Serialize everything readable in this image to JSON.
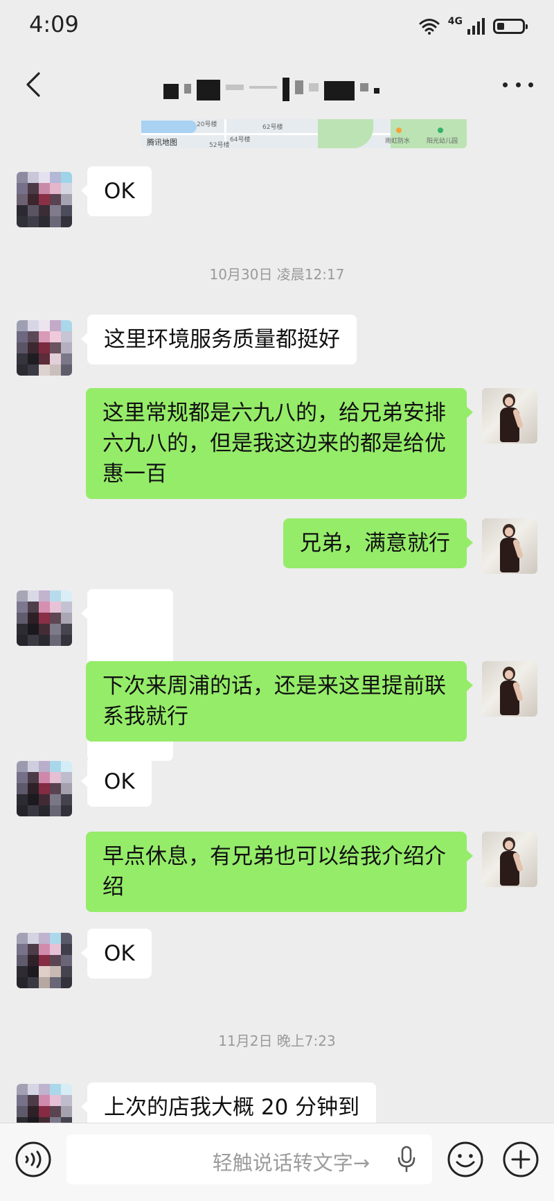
{
  "status_bar": {
    "time": "4:09",
    "network": "4G",
    "battery_percent": 30
  },
  "nav": {
    "title": "",
    "back_icon": "chevron-left-icon",
    "more_icon": "more-dots-icon"
  },
  "map_card": {
    "brand": "腾讯地图",
    "labels": [
      "20号楼",
      "62号楼",
      "64号楼",
      "52号楼",
      "雨虹防水",
      "阳光幼儿园"
    ]
  },
  "messages": [
    {
      "side": "in",
      "kind": "text",
      "text": "OK"
    },
    {
      "kind": "timestamp",
      "text": "10月30日 凌晨12:17"
    },
    {
      "side": "in",
      "kind": "text",
      "text": "这里环境服务质量都挺好"
    },
    {
      "side": "out",
      "kind": "text",
      "text": "这里常规都是六九八的，给兄弟安排六九八的，但是我这边来的都是给优惠一百"
    },
    {
      "side": "out",
      "kind": "text",
      "text": "兄弟，满意就行"
    },
    {
      "side": "in",
      "kind": "emoji",
      "emoji": [
        "thumbs-up-icon",
        "thumbs-up-icon"
      ]
    },
    {
      "side": "out",
      "kind": "text",
      "text": "下次来周浦的话，还是来这里提前联系我就行"
    },
    {
      "side": "in",
      "kind": "text",
      "text": "OK"
    },
    {
      "side": "out",
      "kind": "text",
      "text": "早点休息，有兄弟也可以给我介绍介绍"
    },
    {
      "side": "in",
      "kind": "text",
      "text": "OK"
    },
    {
      "kind": "timestamp",
      "text": "11月2日 晚上7:23"
    },
    {
      "side": "in",
      "kind": "text",
      "text": "上次的店我大概 20 分钟到"
    }
  ],
  "input_bar": {
    "voice_hint": "轻触说话转文字→",
    "voice_icon": "voice-mode-icon",
    "mic_icon": "microphone-icon",
    "emoji_icon": "emoji-icon",
    "plus_icon": "plus-icon"
  },
  "colors": {
    "background": "#EDEDED",
    "bubble_out": "#95EC69",
    "bubble_in": "#FFFFFF",
    "timestamp": "#9A9A9A"
  }
}
